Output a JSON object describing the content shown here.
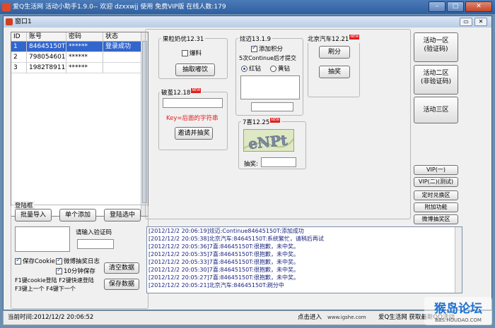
{
  "app": {
    "title": "爱Q生活网 活动小助手1.9.0-- 欢迎  dzxxwjj 使用 免费VIP版      在线人数:179",
    "inner_title": "窗口1",
    "win_buttons": [
      "–",
      "□",
      "✕"
    ],
    "inner_ctrl": [
      "▭",
      "✕"
    ]
  },
  "accounts": {
    "headers": [
      "ID",
      "账号",
      "密码",
      "状态"
    ],
    "rows": [
      {
        "id": "1",
        "account": "84645150T",
        "password": "******",
        "status": "登录成功"
      },
      {
        "id": "2",
        "account": "798054601",
        "password": "******",
        "status": ""
      },
      {
        "id": "3",
        "account": "1982T89112",
        "password": "******",
        "status": ""
      }
    ]
  },
  "login": {
    "group_label": "登陆框",
    "bulk_import": "批量导入",
    "add_single": "单个添加",
    "login_selected": "登陆选中",
    "captcha_prompt": "请输入验证码",
    "captcha_value": "",
    "save_cookie": "保存Cookie",
    "weibo_log": "微博抽奖日志",
    "ten_min_save": "10分钟保存",
    "clear_data": "清空数据",
    "save_data": "保存数据",
    "hotkey1": "F1键cookie登陆  F2键快速登陆",
    "hotkey2": "F3键上一个       F4键下一个"
  },
  "activities": {
    "guolizhuo": {
      "label": "果粒奶优12.31",
      "bao": "爆料",
      "btn": "抽取嘟饮"
    },
    "xuanmai": {
      "label": "炫迈13.1.9",
      "add_points": "添加积分",
      "submit_note": "5次Continue后才提交",
      "red": "红钻",
      "yellow": "黄钻"
    },
    "beijing": {
      "label": "北京汽车12.21",
      "shuafen": "刷分",
      "choujiang": "抽奖"
    },
    "pocan": {
      "label": "破茧12.18",
      "key_hint": "Key=后面的字符串",
      "invite_btn": "邀请并抽奖",
      "key_value": ""
    },
    "qixi": {
      "label": "7喜12.25",
      "captcha_text": "eNPt",
      "choujiang_label": "抽奖:",
      "choujiang_value": ""
    }
  },
  "side": {
    "area1": "活动一区\n(验证码)",
    "area2": "活动二区\n(非验证码)",
    "area3": "活动三区",
    "vip1": "VIP(一)",
    "vip2": "VIP(二)(测试)",
    "timed": "定时兑换区",
    "extra": "附加功能",
    "weibo": "微博抽奖区"
  },
  "log_lines": [
    "[2012/12/2 20:06:19]炫迈:Continue84645150T:添加成功",
    "[2012/12/2 20:05:38]北京汽车:84645150T:系统繁忙，请稍后再试",
    "[2012/12/2 20:05:36]7喜:84645150T:很抱歉，未中奖。",
    "[2012/12/2 20:05:35]7喜:84645150T:很抱歉，未中奖。",
    "[2012/12/2 20:05:33]7喜:84645150T:很抱歉，未中奖。",
    "[2012/12/2 20:05:30]7喜:84645150T:很抱歉，未中奖。",
    "[2012/12/2 20:05:27]7喜:84645150T:很抱歉，未中奖。",
    "[2012/12/2 20:05:21]北京汽车:84645150T:刷分中"
  ],
  "status": {
    "time": "当前时间:2012/12/2 20:06:52",
    "enter": "点击进入",
    "site": "www.igshe.com",
    "promo": "爱Q生活网 获取最新QQ活动"
  },
  "watermark": {
    "text": "猴岛论坛",
    "url": "BBS.HOUDAO.COM"
  },
  "colors": {
    "titlebar": "#2f5f9e",
    "selected_row": "#3366cc",
    "log_text": "#1a237e",
    "hint_red": "#e02020"
  }
}
